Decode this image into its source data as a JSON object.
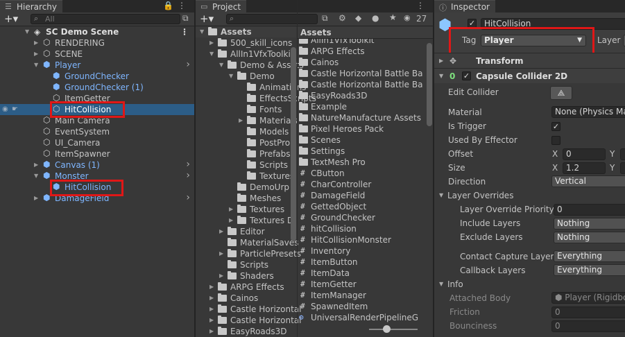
{
  "hierarchy": {
    "tab": "Hierarchy",
    "search_placeholder": "All",
    "scene": "SC Demo Scene",
    "items": [
      {
        "label": "RENDERING",
        "blue": false
      },
      {
        "label": "SCENE",
        "blue": false
      },
      {
        "label": "Player",
        "blue": true
      },
      {
        "label": "GroundChecker",
        "blue": true
      },
      {
        "label": "GroundChecker (1)",
        "blue": true
      },
      {
        "label": "ItemGetter",
        "blue": false
      },
      {
        "label": "HitCollision",
        "blue": false
      },
      {
        "label": "Main Camera",
        "blue": false
      },
      {
        "label": "EventSystem",
        "blue": false
      },
      {
        "label": "UI_Camera",
        "blue": false
      },
      {
        "label": "ItemSpawner",
        "blue": false
      },
      {
        "label": "Canvas (1)",
        "blue": true
      },
      {
        "label": "Monster",
        "blue": true
      },
      {
        "label": "HitCollision",
        "blue": true
      },
      {
        "label": "DamageField",
        "blue": true
      }
    ]
  },
  "project": {
    "tab": "Project",
    "count": "27",
    "tree": [
      "Assets",
      "500_skill_icons",
      "AllIn1VfxToolkit",
      "Demo & Assets",
      "Demo",
      "Animations",
      "EffectsScripts",
      "Fonts",
      "Materials",
      "Models",
      "PostPro",
      "Prefabs",
      "Scripts",
      "Textures",
      "DemoUrp",
      "Meshes",
      "Textures",
      "Textures D",
      "Editor",
      "MaterialSaves",
      "ParticlePresets",
      "Scripts",
      "Shaders",
      "ARPG Effects",
      "Cainos",
      "Castle Horizontal",
      "Castle Horizontal",
      "EasyRoads3D"
    ],
    "assets_header": "Assets",
    "files": [
      {
        "label": "AllIn1VfxToolkit",
        "kind": "folder"
      },
      {
        "label": "ARPG Effects",
        "kind": "folder"
      },
      {
        "label": "Cainos",
        "kind": "folder"
      },
      {
        "label": "Castle Horizontal Battle Ba",
        "kind": "folder"
      },
      {
        "label": "Castle Horizontal Battle Ba",
        "kind": "folder"
      },
      {
        "label": "EasyRoads3D",
        "kind": "folder"
      },
      {
        "label": "Example",
        "kind": "folder"
      },
      {
        "label": "NatureManufacture Assets",
        "kind": "folder"
      },
      {
        "label": "Pixel Heroes Pack",
        "kind": "folder"
      },
      {
        "label": "Scenes",
        "kind": "folder"
      },
      {
        "label": "Settings",
        "kind": "folder"
      },
      {
        "label": "TextMesh Pro",
        "kind": "folder"
      },
      {
        "label": "CButton",
        "kind": "script"
      },
      {
        "label": "CharController",
        "kind": "script"
      },
      {
        "label": "DamageField",
        "kind": "script"
      },
      {
        "label": "GettedObject",
        "kind": "script"
      },
      {
        "label": "GroundChecker",
        "kind": "script"
      },
      {
        "label": "hitCollision",
        "kind": "script"
      },
      {
        "label": "HitCollisionMonster",
        "kind": "script"
      },
      {
        "label": "Inventory",
        "kind": "script"
      },
      {
        "label": "ItemButton",
        "kind": "script"
      },
      {
        "label": "ItemData",
        "kind": "script"
      },
      {
        "label": "ItemGetter",
        "kind": "script"
      },
      {
        "label": "ItemManager",
        "kind": "script"
      },
      {
        "label": "SpawnedItem",
        "kind": "script"
      },
      {
        "label": "UniversalRenderPipelineG",
        "kind": "asset"
      }
    ]
  },
  "inspector": {
    "tab": "Inspector",
    "object_name": "HitCollision",
    "tag_label": "Tag",
    "tag_value": "Player",
    "layer_label": "Layer",
    "transform": "Transform",
    "component": "Capsule Collider 2D",
    "edit_collider": "Edit Collider",
    "material_label": "Material",
    "material_value": "None (Physics Ma",
    "is_trigger": "Is Trigger",
    "used_by_effector": "Used By Effector",
    "offset": "Offset",
    "offset_x": "0",
    "offset_y_label": "Y",
    "size": "Size",
    "size_x": "1.2",
    "direction": "Direction",
    "direction_value": "Vertical",
    "layer_overrides": "Layer Overrides",
    "layer_override_priority": "Layer Override Priority",
    "priority_value": "0",
    "include_layers": "Include Layers",
    "include_value": "Nothing",
    "exclude_layers": "Exclude Layers",
    "exclude_value": "Nothing",
    "contact_capture": "Contact Capture Layers",
    "contact_value": "Everything",
    "callback_layers": "Callback Layers",
    "callback_value": "Everything",
    "info": "Info",
    "attached_body": "Attached Body",
    "attached_value": "Player (Rigidbo",
    "friction": "Friction",
    "friction_value": "0",
    "bounciness": "Bounciness",
    "bounciness_value": "0",
    "x_label": "X"
  },
  "colors": {
    "highlight": "#e01717",
    "selected": "#2c5d87",
    "prefab_blue": "#7fb6ff"
  }
}
